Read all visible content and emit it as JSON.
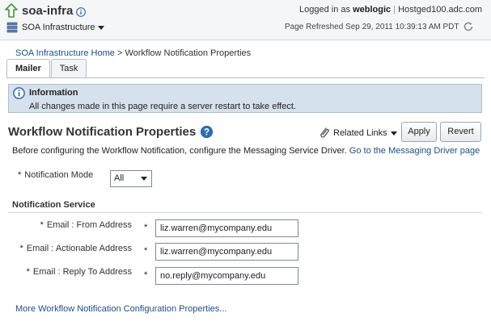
{
  "header": {
    "app_name": "soa-infra",
    "target_menu": "SOA Infrastructure",
    "logged_in_prefix": "Logged in as",
    "username": "weblogic",
    "host_prefix": "Host",
    "host": "ged100.adc.com",
    "page_refreshed": "Page Refreshed Sep 29, 2011 10:39:13 AM PDT"
  },
  "breadcrumb": {
    "home": "SOA Infrastructure Home",
    "separator": ">",
    "current": "Workflow Notification Properties"
  },
  "tabs": [
    {
      "label": "Mailer",
      "active": true
    },
    {
      "label": "Task",
      "active": false
    }
  ],
  "info": {
    "title": "Information",
    "message": "All changes made in this page require a server restart to take effect."
  },
  "page": {
    "title": "Workflow Notification Properties",
    "related_links": "Related Links",
    "apply_label": "Apply",
    "revert_label": "Revert",
    "description": "Before configuring the Workflow Notification, configure the Messaging Service Driver.",
    "driver_link": "Go to the Messaging Driver page"
  },
  "mode": {
    "label": "Notification Mode",
    "value": "All"
  },
  "service": {
    "title": "Notification Service",
    "fields": [
      {
        "label": "Email : From Address",
        "value": "liz.warren@mycompany.edu"
      },
      {
        "label": "Email : Actionable Address",
        "value": "liz.warren@mycompany.edu"
      },
      {
        "label": "Email : Reply To Address",
        "value": "no.reply@mycompany.edu"
      }
    ]
  },
  "required_mark": "*",
  "more_link": "More Workflow Notification Configuration Properties...",
  "colors": {
    "link": "#1d4e89",
    "info_bg": "#d5e1ec",
    "header_bg": "#f4f6f8",
    "arrow_green": "#3f9a2e",
    "info_icon_blue": "#2a6cb6"
  }
}
